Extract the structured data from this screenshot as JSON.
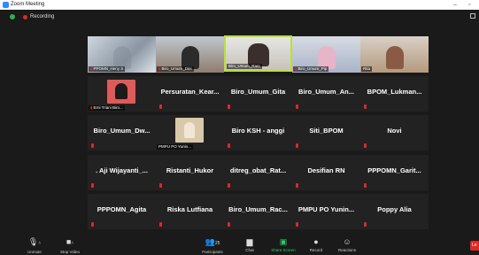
{
  "window": {
    "title": "Zoom Meeting"
  },
  "status": {
    "recording": "Recording"
  },
  "participants_video": [
    {
      "name": "PPOMN_Heny S"
    },
    {
      "name": "Biro_Umum_Dini"
    },
    {
      "name": "Biro_Umum_Rani"
    },
    {
      "name": "Biro_Umum_Pip"
    },
    {
      "name": "Rita"
    }
  ],
  "participant_photo_tile": {
    "name": "Erni Triani Biro..."
  },
  "participant_photo_tile2": {
    "name": "PMPU PO Yunin..."
  },
  "participants_names": [
    "Persuratan_Kear...",
    "Biro_Umum_Gita",
    "Biro_Umum_An...",
    "BPOM_Lukman...",
    "Biro_Umum_Dw...",
    "Biro KSH - anggi",
    "Siti_BPOM",
    "Novi",
    ". Aji Wijayanti_...",
    "Ristanti_Hukor",
    "ditreg_obat_Rat...",
    "Desifian RN",
    "PPPOMN_Garit...",
    "PPPOMN_Agita",
    "Riska Lutfiana",
    "Biro_Umum_Rac...",
    "PMPU PO Yunin...",
    "Poppy Alia"
  ],
  "toolbar": {
    "unmute": "Unmute",
    "stop_video": "Stop Video",
    "participants": "Participants",
    "participants_count": "25",
    "chat": "Chat",
    "share_screen": "Share Screen",
    "record": "Record",
    "reactions": "Reactions",
    "leave": "Le"
  }
}
